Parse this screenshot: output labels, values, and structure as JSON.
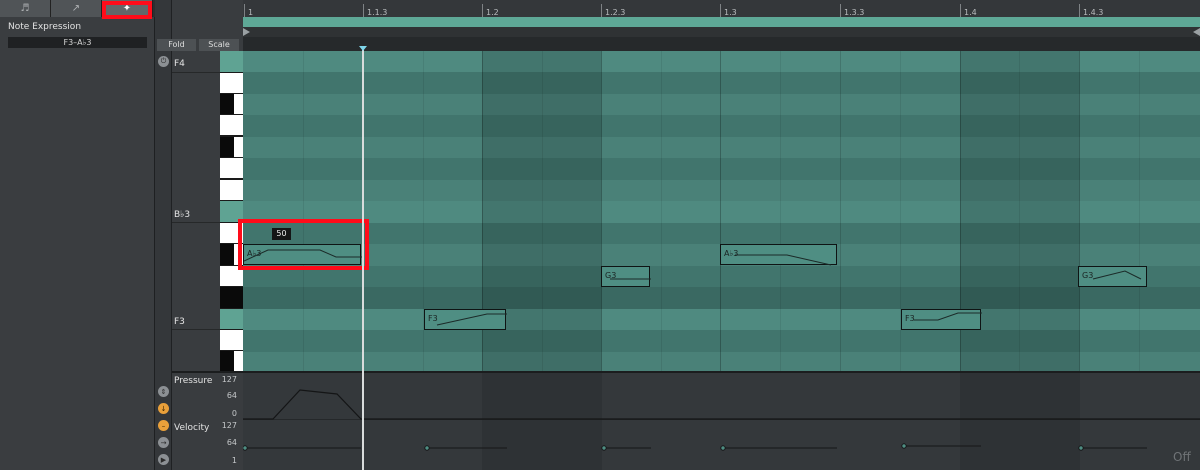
{
  "panel_tabs": [
    {
      "name": "notes-tab",
      "icon": "music-note-icon",
      "glyph": "♬"
    },
    {
      "name": "envelopes-tab",
      "icon": "envelope-icon",
      "glyph": "↗"
    },
    {
      "name": "note-expression-tab",
      "icon": "note-expression-icon",
      "glyph": "✦"
    }
  ],
  "left_panel": {
    "title": "Note Expression",
    "note_range": "F3–A♭3"
  },
  "key_area": {
    "fold_label": "Fold",
    "scale_label": "Scale",
    "pitch_labels": {
      "top": "F4",
      "mid": "B♭3",
      "low": "F3"
    }
  },
  "ruler": {
    "marks": [
      "1",
      "1.1.3",
      "1.2",
      "1.2.3",
      "1.3",
      "1.3.3",
      "1.4",
      "1.4.3"
    ]
  },
  "notes": [
    {
      "label": "A♭3",
      "pitch": "A♭3",
      "start": 1.0,
      "length": 0.5
    },
    {
      "label": "G3",
      "pitch": "G3",
      "start": 2.5,
      "length": 0.2
    },
    {
      "label": "F3",
      "pitch": "F3",
      "start": 1.75,
      "length": 0.33
    },
    {
      "label": "A♭3",
      "pitch": "A♭3",
      "start": 3.0,
      "length": 0.5
    },
    {
      "label": "F3",
      "pitch": "F3",
      "start": 3.75,
      "length": 0.33
    },
    {
      "label": "G3",
      "pitch": "G3",
      "start": 4.5,
      "length": 0.28
    }
  ],
  "velocity_badge": "50",
  "lanes": {
    "pressure": {
      "label": "Pressure",
      "max": "127",
      "mid": "64",
      "min": "0"
    },
    "velocity": {
      "label": "Velocity",
      "max": "127",
      "mid": "64",
      "min": "1"
    },
    "off_label": "Off"
  },
  "colors": {
    "accent": "#5ea896",
    "note_fill": "#4f8e83",
    "highlight": "#ff0c1a",
    "playhead": "#d9dcdc",
    "orange_control": "#e9a03a"
  }
}
